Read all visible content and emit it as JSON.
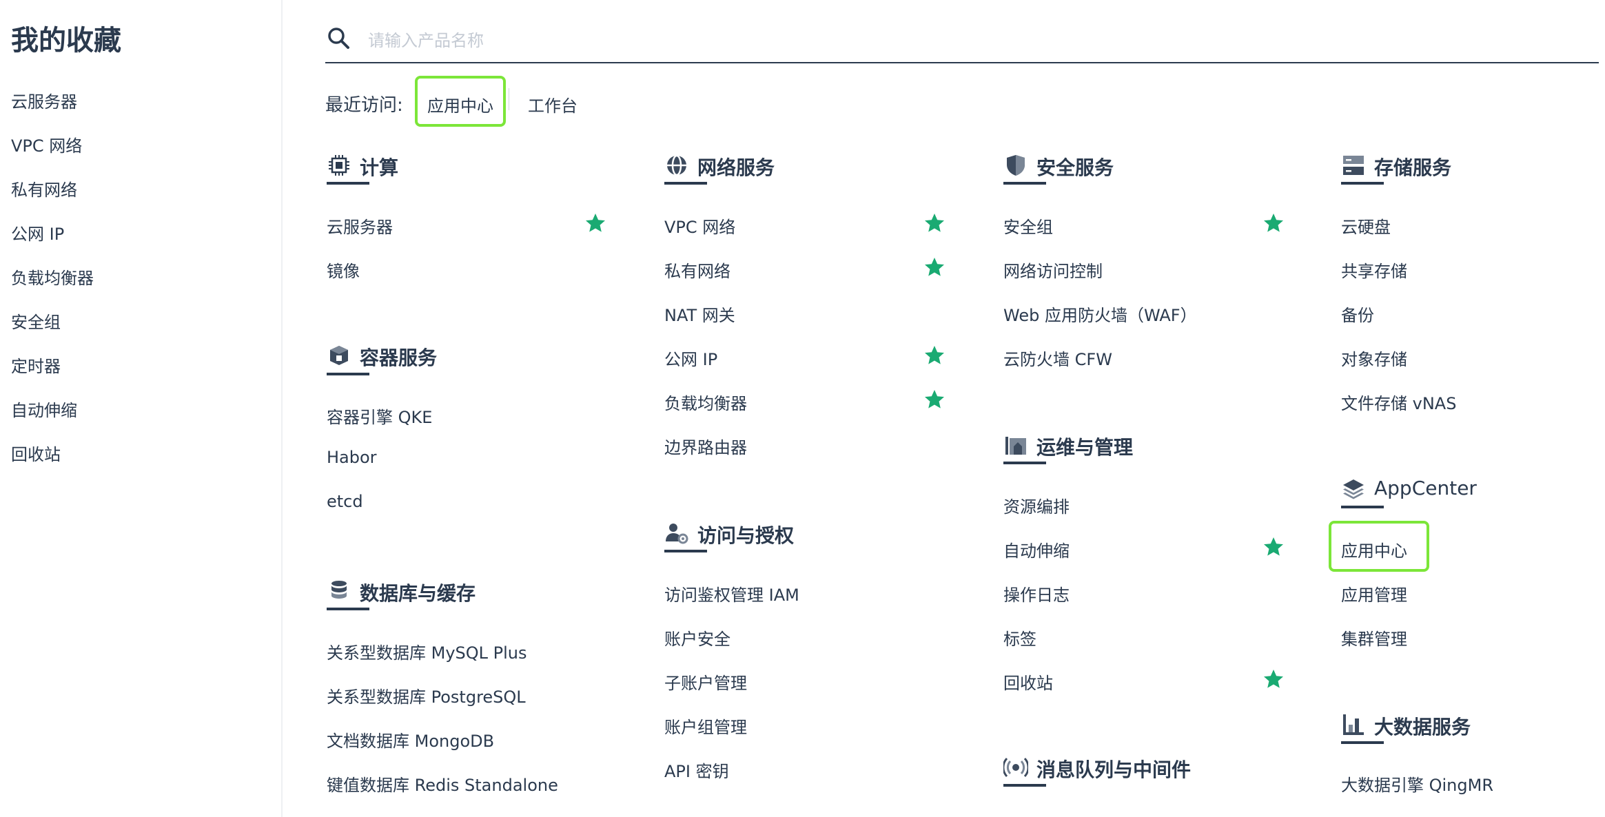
{
  "sidebar": {
    "title": "我的收藏",
    "items": [
      "云服务器",
      "VPC 网络",
      "私有网络",
      "公网 IP",
      "负载均衡器",
      "安全组",
      "定时器",
      "自动伸缩",
      "回收站"
    ]
  },
  "search": {
    "placeholder": "请输入产品名称",
    "value": ""
  },
  "recent": {
    "label": "最近访问:",
    "links": [
      "应用中心",
      "工作台"
    ]
  },
  "colors": {
    "text": "#2b3a4e",
    "star": "#1aaa72",
    "highlight": "#7ce639",
    "placeholder": "#c4cad3"
  },
  "categories": {
    "compute": {
      "title": "计算",
      "icon": "cpu-icon",
      "items": [
        {
          "label": "云服务器",
          "starred": true
        },
        {
          "label": "镜像",
          "starred": false
        }
      ]
    },
    "container": {
      "title": "容器服务",
      "icon": "container-icon",
      "items": [
        {
          "label": "容器引擎 QKE",
          "starred": false
        },
        {
          "label": "Habor",
          "starred": false
        },
        {
          "label": "etcd",
          "starred": false
        }
      ]
    },
    "database": {
      "title": "数据库与缓存",
      "icon": "database-icon",
      "items": [
        {
          "label": "关系型数据库 MySQL Plus",
          "starred": false
        },
        {
          "label": "关系型数据库 PostgreSQL",
          "starred": false
        },
        {
          "label": "文档数据库 MongoDB",
          "starred": false
        },
        {
          "label": "键值数据库 Redis Standalone",
          "starred": false
        }
      ]
    },
    "network": {
      "title": "网络服务",
      "icon": "network-icon",
      "items": [
        {
          "label": "VPC 网络",
          "starred": true
        },
        {
          "label": "私有网络",
          "starred": true
        },
        {
          "label": "NAT 网关",
          "starred": false
        },
        {
          "label": "公网 IP",
          "starred": true
        },
        {
          "label": "负载均衡器",
          "starred": true
        },
        {
          "label": "边界路由器",
          "starred": false
        }
      ]
    },
    "iam": {
      "title": "访问与授权",
      "icon": "user-gear-icon",
      "items": [
        {
          "label": "访问鉴权管理 IAM",
          "starred": false
        },
        {
          "label": "账户安全",
          "starred": false
        },
        {
          "label": "子账户管理",
          "starred": false
        },
        {
          "label": "账户组管理",
          "starred": false
        },
        {
          "label": "API 密钥",
          "starred": false
        }
      ]
    },
    "security": {
      "title": "安全服务",
      "icon": "shield-icon",
      "items": [
        {
          "label": "安全组",
          "starred": true
        },
        {
          "label": "网络访问控制",
          "starred": false
        },
        {
          "label": "Web 应用防火墙（WAF）",
          "starred": false
        },
        {
          "label": "云防火墙 CFW",
          "starred": false
        }
      ]
    },
    "ops": {
      "title": "运维与管理",
      "icon": "ops-icon",
      "items": [
        {
          "label": "资源编排",
          "starred": false
        },
        {
          "label": "自动伸缩",
          "starred": true
        },
        {
          "label": "操作日志",
          "starred": false
        },
        {
          "label": "标签",
          "starred": false
        },
        {
          "label": "回收站",
          "starred": true
        }
      ]
    },
    "mq": {
      "title": "消息队列与中间件",
      "icon": "broadcast-icon",
      "items": []
    },
    "storage": {
      "title": "存储服务",
      "icon": "storage-icon",
      "items": [
        {
          "label": "云硬盘",
          "starred": false
        },
        {
          "label": "共享存储",
          "starred": false
        },
        {
          "label": "备份",
          "starred": false
        },
        {
          "label": "对象存储",
          "starred": false
        },
        {
          "label": "文件存储 vNAS",
          "starred": false
        }
      ]
    },
    "appcenter": {
      "title": "AppCenter",
      "icon": "layers-icon",
      "items": [
        {
          "label": "应用中心",
          "starred": false
        },
        {
          "label": "应用管理",
          "starred": false
        },
        {
          "label": "集群管理",
          "starred": false
        }
      ]
    },
    "bigdata": {
      "title": "大数据服务",
      "icon": "bar-chart-icon",
      "items": [
        {
          "label": "大数据引擎 QingMR",
          "starred": false
        }
      ]
    }
  }
}
